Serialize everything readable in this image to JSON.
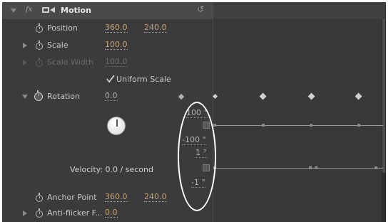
{
  "effect": {
    "name": "Motion",
    "fx_symbol": "fx",
    "icon": "motion-icon",
    "reset_icon": "reset-icon"
  },
  "properties": {
    "position": {
      "label": "Position",
      "x": "360.0",
      "y": "240.0"
    },
    "scale": {
      "label": "Scale",
      "value": "100.0"
    },
    "scale_width": {
      "label": "Scale Width",
      "value": "100.0"
    },
    "uniform_scale": {
      "label": "Uniform Scale",
      "checked": true
    },
    "rotation": {
      "label": "Rotation",
      "value": "0.0"
    },
    "velocity": {
      "label": "Velocity: 0.0 / second"
    },
    "anchor_point": {
      "label": "Anchor Point",
      "x": "360.0",
      "y": "240.0"
    },
    "anti_flicker": {
      "label": "Anti-flicker F...",
      "value": "0.0"
    }
  },
  "graph": {
    "value_max": "100 °",
    "value_min": "-100 °",
    "velocity_max": "1 °",
    "velocity_min": "-1 °"
  },
  "colors": {
    "panel_bg": "#3b3b3b",
    "value_color": "#c7a26e",
    "header_bg": "#4a4a4a",
    "highlight_ellipse": "#ffffff"
  }
}
